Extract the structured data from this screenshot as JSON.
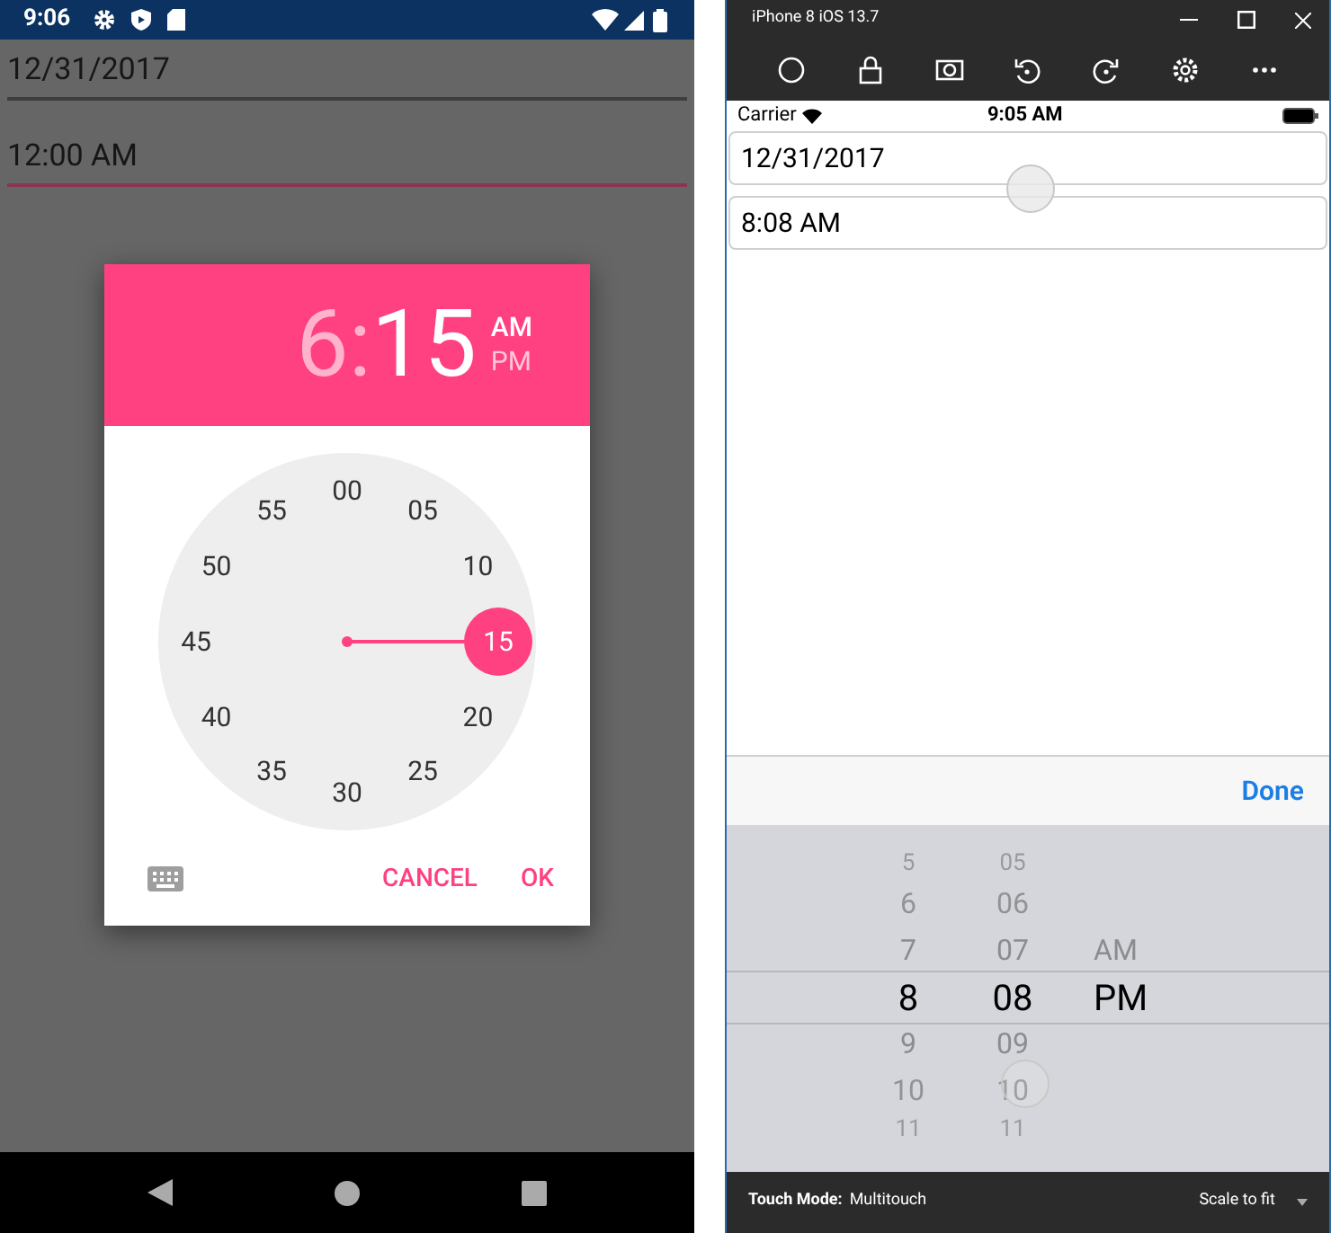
{
  "android": {
    "status_bar": {
      "time": "9:06"
    },
    "date_field": {
      "value": "12/31/2017",
      "focused": false
    },
    "time_field": {
      "value": "12:00 AM",
      "focused": true
    },
    "time_dialog": {
      "hour": {
        "text": "6",
        "selected": false
      },
      "separator": ":",
      "minute": {
        "text": "15",
        "selected": true
      },
      "periods": [
        {
          "label": "AM",
          "selected": true
        },
        {
          "label": "PM",
          "selected": false
        }
      ],
      "dial": [
        {
          "label": "00",
          "selected": false
        },
        {
          "label": "05",
          "selected": false
        },
        {
          "label": "10",
          "selected": false
        },
        {
          "label": "15",
          "selected": true
        },
        {
          "label": "20",
          "selected": false
        },
        {
          "label": "25",
          "selected": false
        },
        {
          "label": "30",
          "selected": false
        },
        {
          "label": "35",
          "selected": false
        },
        {
          "label": "40",
          "selected": false
        },
        {
          "label": "45",
          "selected": false
        },
        {
          "label": "50",
          "selected": false
        },
        {
          "label": "55",
          "selected": false
        }
      ],
      "buttons": [
        {
          "label": "CANCEL"
        },
        {
          "label": "OK"
        }
      ]
    }
  },
  "simulator": {
    "window": {
      "title": "iPhone 8 iOS 13.7"
    },
    "status_bar": {
      "carrier": "Carrier",
      "time": "9:05 AM"
    },
    "date_field": {
      "value": "12/31/2017"
    },
    "time_field": {
      "value": "8:08 AM"
    },
    "done_button": {
      "label": "Done"
    },
    "picker": {
      "hours": [
        {
          "label": "5",
          "selected": false
        },
        {
          "label": "6",
          "selected": false
        },
        {
          "label": "7",
          "selected": false
        },
        {
          "label": "8",
          "selected": true
        },
        {
          "label": "9",
          "selected": false
        },
        {
          "label": "10",
          "selected": false
        },
        {
          "label": "11",
          "selected": false
        }
      ],
      "minutes": [
        {
          "label": "05",
          "selected": false
        },
        {
          "label": "06",
          "selected": false
        },
        {
          "label": "07",
          "selected": false
        },
        {
          "label": "08",
          "selected": true
        },
        {
          "label": "09",
          "selected": false
        },
        {
          "label": "10",
          "selected": false
        },
        {
          "label": "11",
          "selected": false
        }
      ],
      "periods": [
        {
          "label": "AM",
          "selected": false
        },
        {
          "label": "PM",
          "selected": true
        }
      ]
    },
    "footer": {
      "touch_mode": "Touch Mode:",
      "touch_mode_value": "Multitouch",
      "scale": "Scale to fit"
    }
  }
}
